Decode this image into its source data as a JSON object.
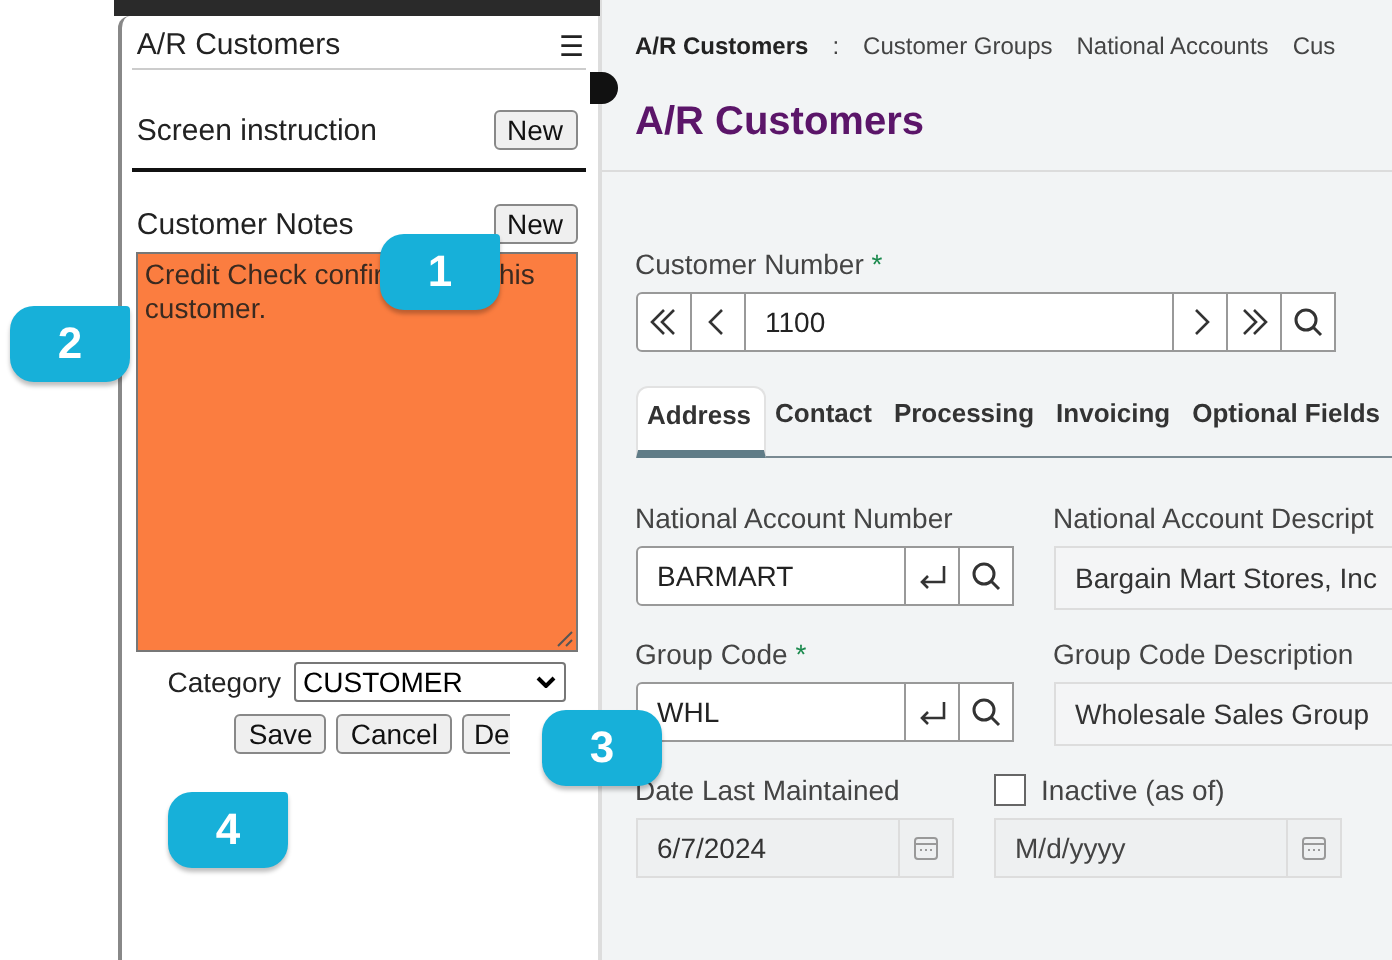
{
  "side_panel": {
    "title": "A/R Customers",
    "menu_icon": "☰",
    "sections": [
      {
        "label": "Screen instruction",
        "button": "New"
      },
      {
        "label": "Customer Notes",
        "button": "New"
      }
    ],
    "note_parts": [
      "Credit Check confir",
      "his",
      "customer."
    ],
    "category_label": "Category",
    "category_value": "CUSTOMER",
    "buttons": [
      "Save",
      "Cancel",
      "De"
    ]
  },
  "callouts": [
    {
      "number": "1"
    },
    {
      "number": "2"
    },
    {
      "number": "3"
    },
    {
      "number": "4"
    }
  ],
  "breadcrumbs": [
    {
      "label": "A/R Customers",
      "selected": true
    },
    {
      "label": ":",
      "selected": false
    },
    {
      "label": "Customer Groups",
      "selected": false
    },
    {
      "label": "National Accounts",
      "selected": false
    },
    {
      "label": "Cus",
      "selected": false
    }
  ],
  "page_title": "A/R Customers",
  "customer_number": {
    "label": "Customer Number",
    "required_mark": "*",
    "value": "1100"
  },
  "tabs": [
    {
      "label": "Address",
      "selected": true
    },
    {
      "label": "Contact",
      "selected": false
    },
    {
      "label": "Processing",
      "selected": false
    },
    {
      "label": "Invoicing",
      "selected": false
    },
    {
      "label": "Optional Fields",
      "selected": false
    }
  ],
  "rows": [
    {
      "left": {
        "label": "National Account Number",
        "required": false,
        "value": "BARMART"
      },
      "right": {
        "label": "National Account Descript",
        "value": "Bargain Mart Stores, Inc"
      }
    },
    {
      "left": {
        "label": "Group Code",
        "required": true,
        "value": "WHL"
      },
      "right": {
        "label": "Group Code Description",
        "value": "Wholesale Sales Group"
      }
    }
  ],
  "required_mark": "*",
  "date_last_maintained": {
    "label": "Date Last Maintained",
    "value": "6/7/2024"
  },
  "inactive": {
    "label": "Inactive (as of)",
    "checked": false,
    "placeholder": "M/d/yyyy"
  }
}
